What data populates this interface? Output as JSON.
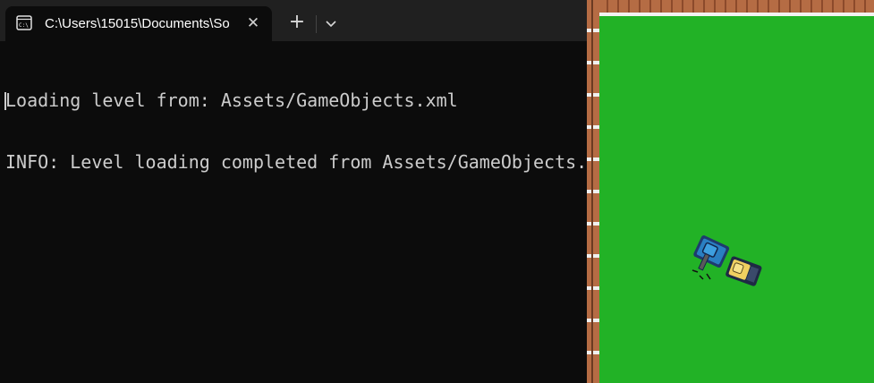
{
  "terminal": {
    "tab_title": "C:\\Users\\15015\\Documents\\So",
    "tab_icon": "terminal-prompt-icon",
    "close_glyph": "✕",
    "new_tab_glyph": "+",
    "dropdown_icon": "chevron-down-icon",
    "lines": [
      "Loading level from: Assets/GameObjects.xml",
      "INFO: Level loading completed from Assets/GameObjects.xml"
    ]
  },
  "game": {
    "background_color": "#22b226",
    "wall_color": "#b56c44",
    "player_tank_color": "#2a7fc2",
    "enemy_tank_color": "#f0d060"
  }
}
